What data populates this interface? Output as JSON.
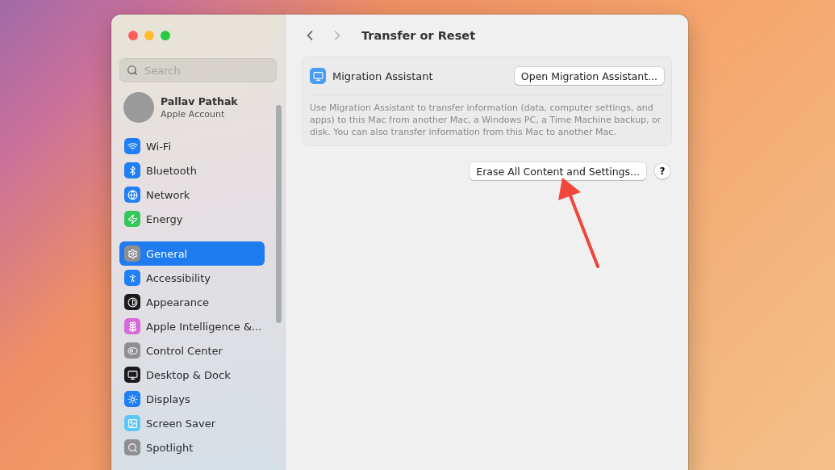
{
  "sidebar": {
    "search": {
      "placeholder": "Search"
    },
    "account": {
      "name": "Pallav Pathak",
      "subtitle": "Apple Account"
    },
    "groups": [
      {
        "items": [
          {
            "label": "Wi-Fi",
            "color": "#1f7ff5",
            "selected": false
          },
          {
            "label": "Bluetooth",
            "color": "#1f7ff5",
            "selected": false
          },
          {
            "label": "Network",
            "color": "#1f7ff5",
            "selected": false
          },
          {
            "label": "Energy",
            "color": "#34c759",
            "selected": false
          }
        ]
      },
      {
        "items": [
          {
            "label": "General",
            "color": "#8e8e93",
            "selected": true
          },
          {
            "label": "Accessibility",
            "color": "#1f7ff5",
            "selected": false
          },
          {
            "label": "Appearance",
            "color": "#1c1c1e",
            "selected": false
          },
          {
            "label": "Apple Intelligence &...",
            "color": "#d66ad9",
            "selected": false
          },
          {
            "label": "Control Center",
            "color": "#8e8e93",
            "selected": false
          },
          {
            "label": "Desktop & Dock",
            "color": "#1c1c1e",
            "selected": false
          },
          {
            "label": "Displays",
            "color": "#1f7ff5",
            "selected": false
          },
          {
            "label": "Screen Saver",
            "color": "#5ac8fa",
            "selected": false
          },
          {
            "label": "Spotlight",
            "color": "#8e8e93",
            "selected": false
          }
        ]
      }
    ]
  },
  "toolbar": {
    "title": "Transfer or Reset",
    "back_disabled": false,
    "forward_disabled": true
  },
  "migration": {
    "title": "Migration Assistant",
    "button": "Open Migration Assistant...",
    "description": "Use Migration Assistant to transfer information (data, computer settings, and apps) to this Mac from another Mac, a Windows PC, a Time Machine backup, or disk. You can also transfer information from this Mac to another Mac."
  },
  "erase": {
    "button": "Erase All Content and Settings...",
    "help": "?"
  }
}
